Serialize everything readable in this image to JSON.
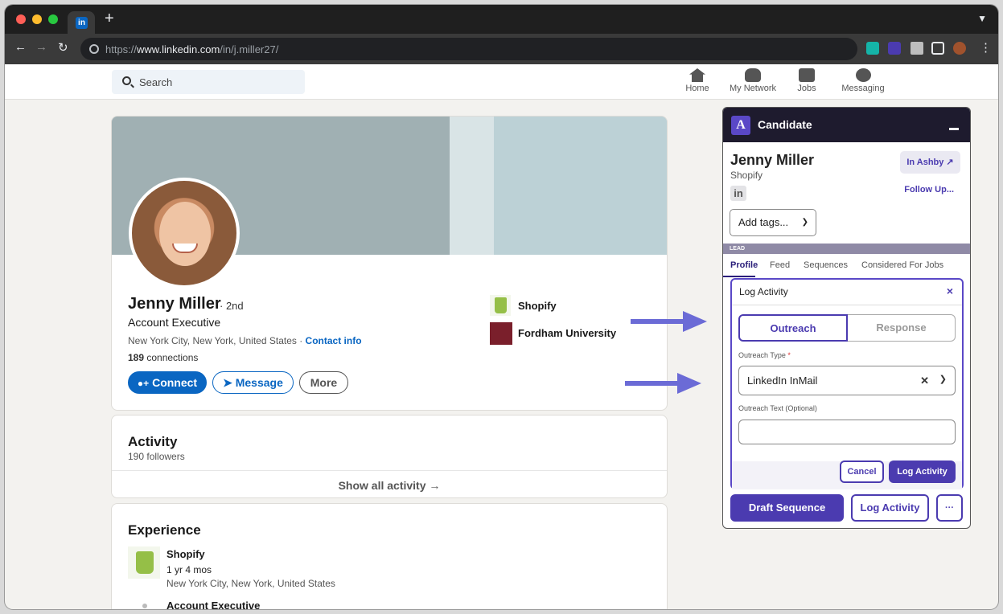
{
  "browser": {
    "tab_icon": "in",
    "new_tab": "+",
    "url_prefix": "https://",
    "url_domain": "www.linkedin.com",
    "url_path": "/in/j.miller27/"
  },
  "linkedin_nav": {
    "search_placeholder": "Search",
    "items": [
      {
        "label": "Home"
      },
      {
        "label": "My Network"
      },
      {
        "label": "Jobs"
      },
      {
        "label": "Messaging"
      }
    ]
  },
  "profile": {
    "name": "Jenny Miller",
    "degree": "· 2nd",
    "headline": "Account Executive",
    "location": "New York City, New York, United States · ",
    "contact_info": "Contact info",
    "connections_count": "189",
    "connections_label": " connections",
    "buttons": {
      "connect": "Connect",
      "message": "Message",
      "more": "More"
    },
    "companies": [
      {
        "name": "Shopify"
      },
      {
        "name": "Fordham University"
      }
    ]
  },
  "activity": {
    "title": "Activity",
    "followers": "190 followers",
    "show_all": "Show all activity →"
  },
  "experience": {
    "title": "Experience",
    "items": [
      {
        "company": "Shopify",
        "duration": "1 yr 4 mos",
        "location": "New York City, New York, United States"
      }
    ],
    "next_role": "Account Executive"
  },
  "ashby": {
    "logo": "A",
    "title": "Candidate",
    "candidate_name": "Jenny Miller",
    "company": "Shopify",
    "in_ashby": "In Ashby ↗",
    "follow_up": "Follow Up...",
    "linkedin_badge": "in",
    "add_tags": "Add tags...",
    "stage": "LEAD",
    "tabs": [
      "Profile",
      "Feed",
      "Sequences",
      "Considered For Jobs"
    ],
    "log_panel": {
      "title": "Log Activity",
      "close": "×",
      "segments": {
        "outreach": "Outreach",
        "response": "Response"
      },
      "type_label": "Outreach Type",
      "required_mark": "*",
      "type_value": "LinkedIn InMail",
      "text_label": "Outreach Text (Optional)",
      "text_value": "",
      "cancel": "Cancel",
      "submit": "Log Activity"
    },
    "footer": {
      "draft_sequence": "Draft Sequence",
      "log_activity": "Log Activity",
      "more": "···"
    },
    "accent_color": "#4b3bb0"
  }
}
